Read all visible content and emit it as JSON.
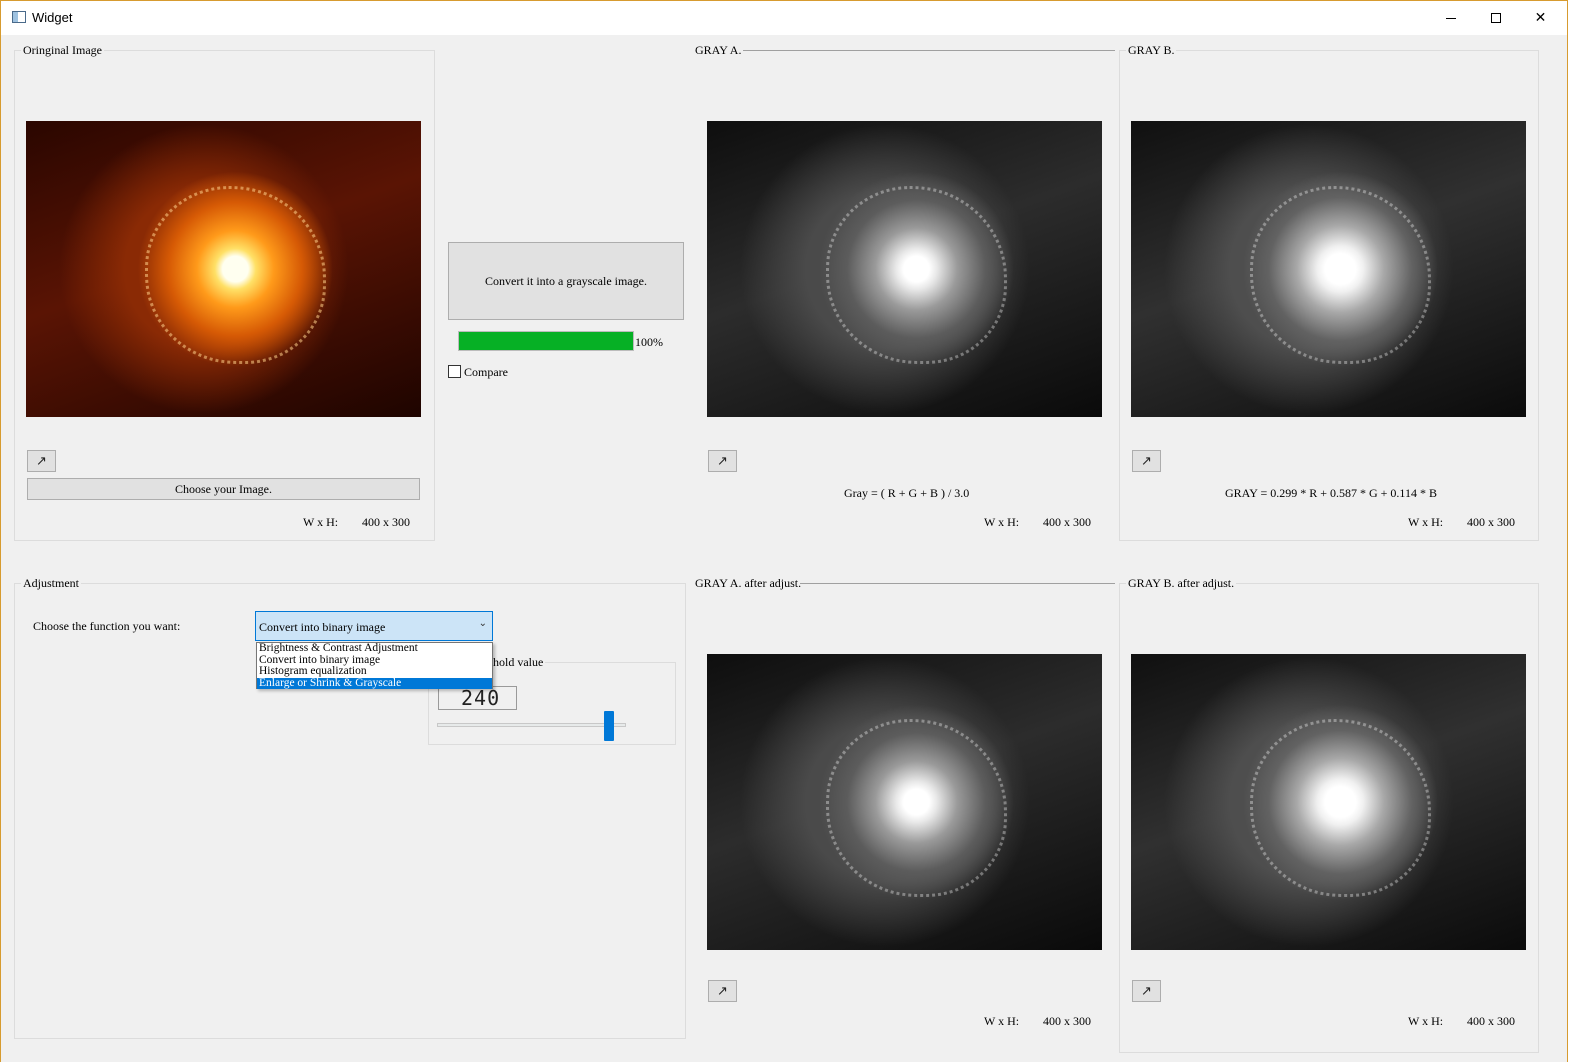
{
  "window": {
    "title": "Widget",
    "close_glyph": "✕"
  },
  "original": {
    "title": "Oringinal Image",
    "choose_button": "Choose your Image.",
    "size_label": "W x H:",
    "size_value": "400 x 300",
    "expand_icon": "↗"
  },
  "convert": {
    "button": "Convert it into a grayscale image.",
    "progress_percent": 100,
    "progress_text": "100%",
    "compare_label": "Compare",
    "compare_checked": false
  },
  "gray_a": {
    "title": "GRAY A.",
    "formula": "Gray = ( R + G + B ) / 3.0",
    "size_label": "W x H:",
    "size_value": "400 x 300",
    "expand_icon": "↗"
  },
  "gray_b": {
    "title": "GRAY B.",
    "formula": "GRAY = 0.299 * R + 0.587 * G + 0.114 * B",
    "size_label": "W x H:",
    "size_value": "400 x 300",
    "expand_icon": "↗"
  },
  "adjustment": {
    "title": "Adjustment",
    "choose_label": "Choose the function you want:",
    "selected": "Convert into binary image",
    "options": [
      "Brightness & Contrast Adjustment",
      "Convert into binary image",
      "Histogram equalization",
      "Enlarge or Shrink & Grayscale"
    ],
    "highlighted_option_index": 3,
    "threshold_title_visible": "hold value",
    "threshold_value": "240",
    "slider_value": 240,
    "slider_max": 255
  },
  "gray_a_adjusted": {
    "title": "GRAY A. after adjust.",
    "size_label": "W x H:",
    "size_value": "400 x 300",
    "expand_icon": "↗"
  },
  "gray_b_adjusted": {
    "title": "GRAY B. after adjust.",
    "size_label": "W x H:",
    "size_value": "400 x 300",
    "expand_icon": "↗"
  }
}
